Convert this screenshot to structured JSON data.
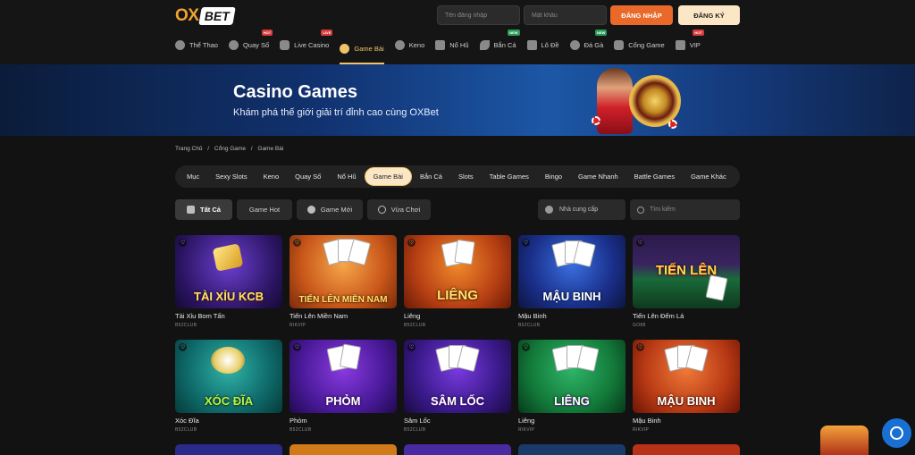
{
  "header": {
    "logo_ox": "OX",
    "logo_bet": "BET",
    "username_placeholder": "Tên đăng nhập",
    "password_placeholder": "Mật khẩu",
    "login_label": "ĐĂNG NHẬP",
    "register_label": "ĐĂNG KÝ"
  },
  "nav": [
    {
      "label": "Thể Thao",
      "icon": "soccer-ball-icon",
      "badge": ""
    },
    {
      "label": "Quay Số",
      "icon": "lottery-ball-icon",
      "badge": "HOT"
    },
    {
      "label": "Live Casino",
      "icon": "mask-icon",
      "badge": "LIVE"
    },
    {
      "label": "Game Bài",
      "icon": "spade-icon",
      "badge": "",
      "active": true
    },
    {
      "label": "Keno",
      "icon": "keno-ball-icon",
      "badge": ""
    },
    {
      "label": "Nổ Hũ",
      "icon": "slot-machine-icon",
      "badge": ""
    },
    {
      "label": "Bắn Cá",
      "icon": "fish-icon",
      "badge": "NEW"
    },
    {
      "label": "Lô Đề",
      "icon": "lottery-ticket-icon",
      "badge": ""
    },
    {
      "label": "Đá Gà",
      "icon": "rooster-icon",
      "badge": "NEW"
    },
    {
      "label": "Cổng Game",
      "icon": "gamepad-icon",
      "badge": ""
    },
    {
      "label": "VIP",
      "icon": "crown-icon",
      "badge": "HOT"
    }
  ],
  "banner": {
    "title": "Casino Games",
    "subtitle": "Khám phá thế giới giải trí đỉnh cao cùng OXBet"
  },
  "breadcrumb": [
    "Trang Chủ",
    "/",
    "Cổng Game",
    "/",
    "Game Bài"
  ],
  "categories": [
    "Mục",
    "Sexy Slots",
    "Keno",
    "Quay Số",
    "Nổ Hũ",
    "Game Bài",
    "Bắn Cá",
    "Slots",
    "Table Games",
    "Bingo",
    "Game Nhanh",
    "Battle Games",
    "Game Khác"
  ],
  "filters": {
    "all": "Tất Cả",
    "hot": "Game Hot",
    "new": "Game Mới",
    "recent": "Vừa Chơi",
    "provider": "Nhà cung cấp",
    "search_placeholder": "Tìm kiếm"
  },
  "games": [
    {
      "name": "Tài Xỉu Bom Tấn",
      "provider": "B52CLUB",
      "art": "TÀI XỈU KCB"
    },
    {
      "name": "Tiến Lên Miền Nam",
      "provider": "RIKVIP",
      "art": "TIẾN LÊN MIỀN NAM"
    },
    {
      "name": "Liêng",
      "provider": "B52CLUB",
      "art": "LIÊNG"
    },
    {
      "name": "Mậu Binh",
      "provider": "B52CLUB",
      "art": "MẬU BINH"
    },
    {
      "name": "Tiến Lên Đếm Lá",
      "provider": "GO88",
      "art": "TIẾN LÊN"
    },
    {
      "name": "Xóc Đĩa",
      "provider": "B52CLUB",
      "art": "XÓC ĐĨA"
    },
    {
      "name": "Phỏm",
      "provider": "B52CLUB",
      "art": "PHỎM"
    },
    {
      "name": "Sâm Lốc",
      "provider": "B52CLUB",
      "art": "SÂM LỐC"
    },
    {
      "name": "Liêng",
      "provider": "RIKVIP",
      "art": "LIÊNG"
    },
    {
      "name": "Mậu Binh",
      "provider": "RIKVIP",
      "art": "MẬU BINH"
    }
  ]
}
